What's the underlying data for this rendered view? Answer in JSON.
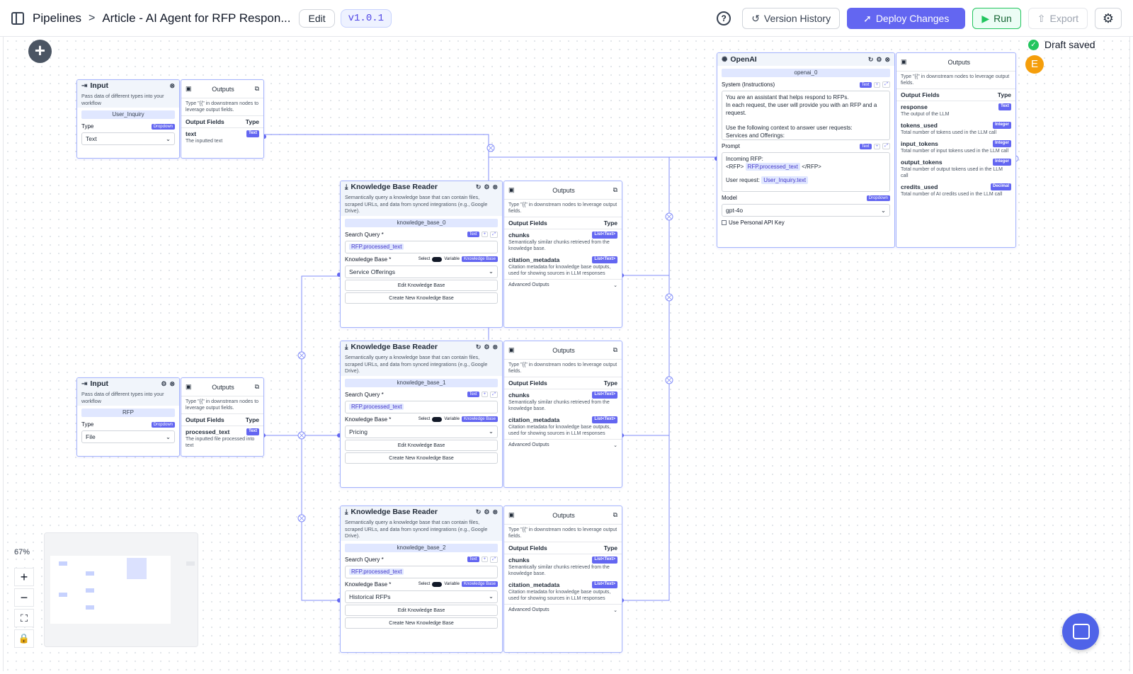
{
  "header": {
    "breadcrumb_root": "Pipelines",
    "breadcrumb_sep": ">",
    "pipeline_name": "Article - AI Agent for RFP Respon...",
    "edit_label": "Edit",
    "version": "v1.0.1",
    "help_label": "?",
    "version_history_label": "Version History",
    "deploy_label": "Deploy Changes",
    "run_label": "Run",
    "export_label": "Export"
  },
  "status": {
    "draft_label": "Draft saved",
    "avatar_initial": "E"
  },
  "common": {
    "outputs_title": "Outputs",
    "outputs_desc": "Type \"{{\" in downstream nodes to leverage output fields.",
    "output_fields": "Output Fields",
    "type_col": "Type",
    "input_title": "Input",
    "input_desc": "Pass data of different types into your workflow",
    "type_label": "Type",
    "dropdown_tag": "Dropdown",
    "text_tag": "Text",
    "kb_title": "Knowledge Base Reader",
    "kb_desc": "Semantically query a knowledge base that can contain files, scraped URLs, and data from synced integrations (e.g., Google Drive).",
    "search_query": "Search Query *",
    "knowledge_base_label": "Knowledge Base *",
    "select_label": "Select",
    "variable_label": "Variable",
    "kb_tag": "Knowledge Base",
    "rfp_chip": "RFP.processed_text",
    "edit_kb": "Edit Knowledge Base",
    "create_kb": "Create New Knowledge Base",
    "chunks": "chunks",
    "chunks_desc": "Semantically similar chunks retrieved from the knowledge base.",
    "citation": "citation_metadata",
    "citation_desc": "Citation metadata for knowledge base outputs, used for showing sources in LLM responses",
    "list_text": "List<Text>",
    "advanced": "Advanced Outputs"
  },
  "input_user": {
    "id": "User_Inquiry",
    "type_value": "Text",
    "field": "text",
    "field_desc": "The inputted text"
  },
  "input_rfp": {
    "id": "RFP",
    "type_value": "File",
    "field": "processed_text",
    "field_desc": "The inputted file processed into text"
  },
  "kb0": {
    "id": "knowledge_base_0",
    "kb_value": "Service Offerings"
  },
  "kb1": {
    "id": "knowledge_base_1",
    "kb_value": "Pricing"
  },
  "kb2": {
    "id": "knowledge_base_2",
    "kb_value": "Historical RFPs"
  },
  "openai": {
    "title": "OpenAI",
    "id": "openai_0",
    "system_label": "System (Instructions)",
    "system_text_1": "You are an assistant that helps respond to RFPs.",
    "system_text_2": "In each request, the user will provide you with an RFP and a request.",
    "system_text_3": "Use the following context to answer user requests:",
    "system_text_4": "Services and Offerings:",
    "prompt_label": "Prompt",
    "prompt_line1": "Incoming RFP:",
    "prompt_rfp_open": "<RFP>",
    "prompt_rfp_close": "</RFP>",
    "prompt_user": "User request:",
    "user_chip": "User_Inquiry.text",
    "model_label": "Model",
    "model_value": "gpt-4o",
    "personal_key": "Use Personal API Key",
    "outputs": [
      {
        "name": "response",
        "type": "Text",
        "desc": "The output of the LLM"
      },
      {
        "name": "tokens_used",
        "type": "Integer",
        "desc": "Total number of tokens used in the LLM call"
      },
      {
        "name": "input_tokens",
        "type": "Integer",
        "desc": "Total number of input tokens used in the LLM call"
      },
      {
        "name": "output_tokens",
        "type": "Integer",
        "desc": "Total number of output tokens used in the LLM call"
      },
      {
        "name": "credits_used",
        "type": "Decimal",
        "desc": "Total number of AI credits used in the LLM call"
      }
    ]
  },
  "zoom": {
    "level": "67%"
  }
}
